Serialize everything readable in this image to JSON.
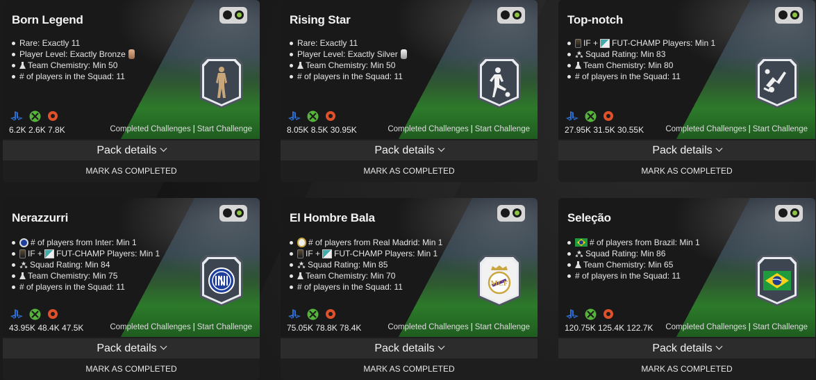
{
  "common": {
    "pack_details": "Pack details",
    "mark_completed": "MARK AS COMPLETED",
    "completed_challenges": "Completed Challenges",
    "start_challenge": "Start Challenge",
    "separator": "|"
  },
  "cards": [
    {
      "title": "Born Legend",
      "requirements": [
        "Rare: Exactly 11",
        "Player Level: Exactly Bronze",
        "Team Chemistry: Min 50",
        "# of players in the Squad: 11"
      ],
      "prices": "6.2K 2.6K 7.8K",
      "badge_icon": "player-silhouette-icon"
    },
    {
      "title": "Rising Star",
      "requirements": [
        "Rare: Exactly 11",
        "Player Level: Exactly Silver",
        "Team Chemistry: Min 50",
        "# of players in the Squad: 11"
      ],
      "prices": "8.05K 8.5K 30.95K",
      "badge_icon": "kicking-player-icon"
    },
    {
      "title": "Top-notch",
      "requirements": [
        "IF +",
        "FUT-CHAMP Players: Min 1",
        "Squad Rating: Min 83",
        "Team Chemistry: Min 80",
        "# of players in the Squad: 11"
      ],
      "prices": "27.95K 31.5K 30.55K",
      "badge_icon": "bicycle-kick-icon"
    },
    {
      "title": "Nerazzurri",
      "requirements": [
        "# of players from Inter: Min 1",
        "IF +",
        "FUT-CHAMP Players: Min 1",
        "Squad Rating: Min 84",
        "Team Chemistry: Min 75",
        "# of players in the Squad: 11"
      ],
      "prices": "43.95K 48.4K 47.5K",
      "badge_icon": "inter-crest-icon"
    },
    {
      "title": "El Hombre Bala",
      "requirements": [
        "# of players from Real Madrid: Min 1",
        "IF +",
        "FUT-CHAMP Players: Min 1",
        "Squad Rating: Min 85",
        "Team Chemistry: Min 70",
        "# of players in the Squad: 11"
      ],
      "prices": "75.05K 78.8K 78.4K",
      "badge_icon": "real-madrid-crest-icon"
    },
    {
      "title": "Seleção",
      "requirements": [
        "# of players from Brazil: Min 1",
        "Squad Rating: Min 86",
        "Team Chemistry: Min 65",
        "# of players in the Squad: 11"
      ],
      "prices": "120.75K 125.4K 122.7K",
      "badge_icon": "brazil-flag-icon"
    }
  ],
  "colors": {
    "toggle_indicator": "#8bc53f",
    "playstation": "#2e6fd0",
    "xbox": "#55b43a",
    "origin": "#e0512a"
  }
}
